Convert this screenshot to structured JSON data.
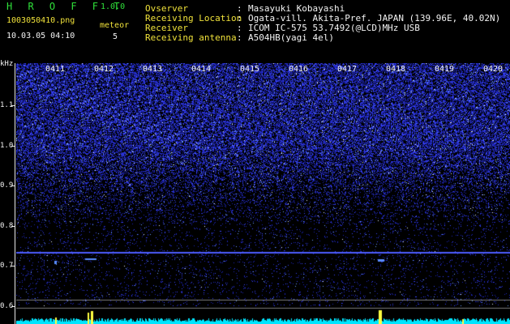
{
  "header": {
    "app_title": "H R O F F T",
    "version": "1.0.0",
    "filename": "1003050410.png",
    "datetime": "10.03.05 04:10",
    "meteor_label": "meteor",
    "meteor_count": "5"
  },
  "info": [
    {
      "label": "Ovserver",
      "value": "Masayuki Kobayashi"
    },
    {
      "label": "Receiving Location",
      "value": "Ogata-vill. Akita-Pref. JAPAN (139.96E, 40.02N)"
    },
    {
      "label": "Receiver",
      "value": "ICOM IC-575 53.7492(@LCD)MHz USB"
    },
    {
      "label": "Receiving antenna",
      "value": "A504HB(yagi 4el)"
    }
  ],
  "info_separator": ":",
  "colors": {
    "background": "#000000",
    "title_green": "#2fe03a",
    "label_yellow": "#f0e23a",
    "noise_blue": "#2f3cff",
    "level_cyan": "#00e5ff",
    "spike_yellow": "#ffff40"
  },
  "chart_data": {
    "type": "heatmap",
    "y_unit": "kHz",
    "y_ticks": [
      "1.1",
      "1.0",
      "0.9",
      "0.8",
      "0.7",
      "0.6"
    ],
    "x_ticks": [
      "0411",
      "0412",
      "0413",
      "0414",
      "0415",
      "0416",
      "0417",
      "0418",
      "0419",
      "0420"
    ],
    "carrier_khz": 0.74
  }
}
